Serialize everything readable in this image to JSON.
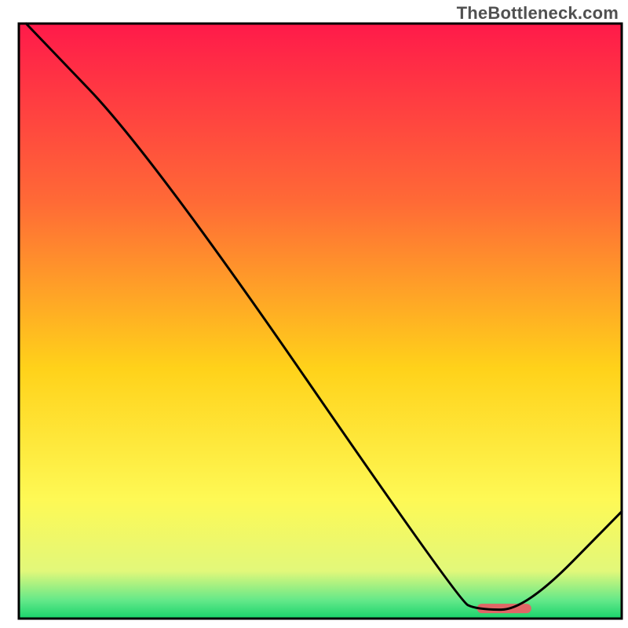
{
  "watermark": "TheBottleneck.com",
  "chart_data": {
    "type": "line",
    "title": "",
    "xlabel": "",
    "ylabel": "",
    "xlim": [
      0,
      100
    ],
    "ylim": [
      0,
      100
    ],
    "grid": false,
    "series": [
      {
        "name": "curve",
        "color": "#000000",
        "points": [
          {
            "x": 1.2,
            "y": 100
          },
          {
            "x": 22,
            "y": 78
          },
          {
            "x": 73,
            "y": 3
          },
          {
            "x": 76,
            "y": 1.5
          },
          {
            "x": 84,
            "y": 1.5
          },
          {
            "x": 100,
            "y": 18
          }
        ]
      }
    ],
    "marker": {
      "x_start": 76,
      "x_end": 85,
      "y": 1.7,
      "color": "#e06666"
    },
    "background_gradient": {
      "stops": [
        {
          "offset": 0,
          "color": "#ff1a4a"
        },
        {
          "offset": 30,
          "color": "#ff6a36"
        },
        {
          "offset": 58,
          "color": "#ffd21a"
        },
        {
          "offset": 80,
          "color": "#fef955"
        },
        {
          "offset": 92,
          "color": "#e2f87a"
        },
        {
          "offset": 97,
          "color": "#62e889"
        },
        {
          "offset": 100,
          "color": "#18d36b"
        }
      ]
    },
    "frame_color": "#000000",
    "frame_width": 3
  }
}
